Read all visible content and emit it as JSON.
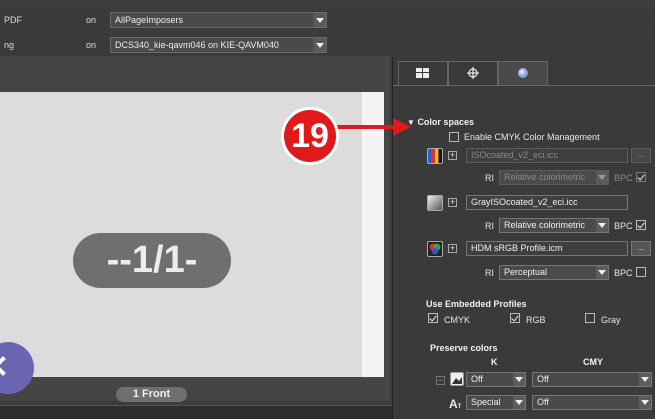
{
  "toolbar": {
    "row1": {
      "label": "PDF",
      "on": "on",
      "value": "AllPageImposers"
    },
    "row2": {
      "label": "ng",
      "on": "on",
      "value": "DCS340_kie-qavm046 on KIE-QAVM040"
    }
  },
  "canvas": {
    "page_label": "--1/1-",
    "front_label": "1 Front"
  },
  "panel": {
    "tabs": [
      {
        "icon": "layout-grid-icon"
      },
      {
        "icon": "crosshair-icon"
      },
      {
        "icon": "color-wheel-icon"
      }
    ],
    "color_spaces": {
      "title": "Color spaces",
      "enable_label": "Enable CMYK Color Management",
      "enable_checked": false,
      "profiles": [
        {
          "icon": "cmyk-icon",
          "value": "ISOcoated_v2_eci.icc",
          "dim": true,
          "ri_label": "RI",
          "ri_value": "Relative colorimetric",
          "bpc_label": "BPC",
          "bpc_checked": true,
          "more": "..."
        },
        {
          "icon": "gray-icon",
          "value": "GrayISOcoated_v2_eci.icc",
          "dim": false,
          "ri_label": "RI",
          "ri_value": "Relative colorimetric",
          "bpc_label": "BPC",
          "bpc_checked": true,
          "more": "..."
        },
        {
          "icon": "rgb-icon",
          "value": "HDM sRGB Profile.icm",
          "dim": false,
          "ri_label": "RI",
          "ri_value": "Perceptual",
          "bpc_label": "BPC",
          "bpc_checked": false,
          "more": "..."
        }
      ]
    },
    "embedded": {
      "title": "Use Embedded Profiles",
      "items": [
        {
          "label": "CMYK",
          "checked": true
        },
        {
          "label": "RGB",
          "checked": true
        },
        {
          "label": "Gray",
          "checked": false
        }
      ]
    },
    "preserve": {
      "title": "Preserve colors",
      "col_k": "K",
      "col_cmy": "CMY",
      "rows": [
        {
          "k_value": "Off",
          "cmy_value": "Off"
        },
        {
          "k_value": "Special",
          "cmy_value": "Off"
        }
      ]
    }
  },
  "annotation": {
    "number": "19"
  },
  "colors": {
    "annotation_red": "#e01a1a",
    "page_bg": "#dcdcdc",
    "badge": "#6f6f6f",
    "accent_purple": "#6b64b0"
  }
}
